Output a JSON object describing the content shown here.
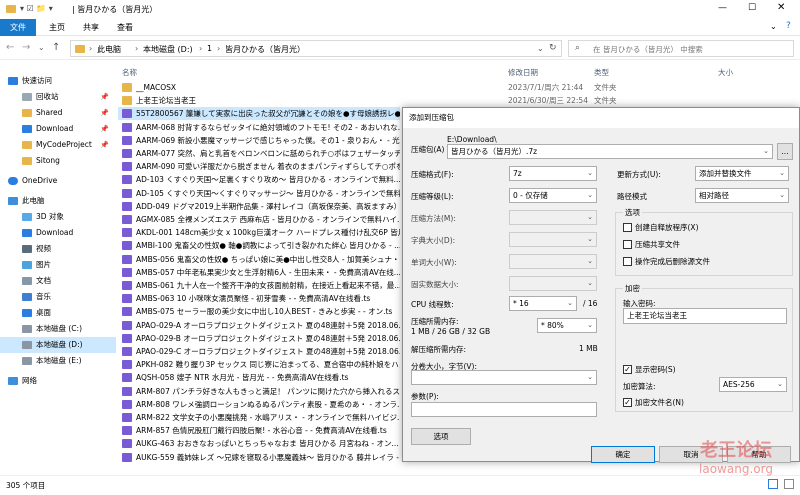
{
  "window": {
    "title": "| 皆月ひかる（皆月光）"
  },
  "ribbon": {
    "tabs": [
      "文件",
      "主页",
      "共享",
      "查看"
    ]
  },
  "address": {
    "path": [
      "此电脑",
      "本地磁盘 (D:)",
      "1",
      "皆月ひかる（皆月光）"
    ],
    "search_placeholder": "在 皆月ひかる（皆月光） 中搜索"
  },
  "sidebar": {
    "items": [
      "快速访问",
      "回收站",
      "Shared",
      "Download",
      "MyCodeProject",
      "Sitong",
      "OneDrive",
      "此电脑",
      "3D 对象",
      "Download",
      "视频",
      "图片",
      "文档",
      "音乐",
      "桌面",
      "本地磁盘 (C:)",
      "本地磁盘 (D:)",
      "本地磁盘 (E:)",
      "网络"
    ]
  },
  "columns": {
    "name": "名称",
    "date": "修改日期",
    "type": "类型",
    "size": "大小"
  },
  "files": [
    {
      "name": "__MACOSX",
      "date": "2023/7/1/周六 21:44",
      "type": "文件夹",
      "kind": "folder"
    },
    {
      "name": "上老王论坛当老王",
      "date": "2021/6/30/周三 22:54",
      "type": "文件夹",
      "kind": "folder"
    },
    {
      "name": "55T2800567 簾嫌して実家に出戻った叔父が冗謙とその娘を●す母娘誘拐レ●...",
      "kind": "video"
    },
    {
      "name": "AARM-068 肘背するならゼッタイに絶対領域のフトモモ! その2 - あおいれな...",
      "kind": "video"
    },
    {
      "name": "AARM-069 新設小悪魔マッサージで感じちゃった僕。その1 - 泉りおん・ - 光...",
      "kind": "video"
    },
    {
      "name": "AARM-077 突然、肩と乳首をベロンベロンに舐められチ○ポはフェザータッチ...",
      "kind": "video"
    },
    {
      "name": "AARM-090 可愛い洋服だから脱ぎません 着衣のままパンティずらしてチ○ポを...",
      "kind": "video"
    },
    {
      "name": "AD-103 くすぐり天国～足裏くすぐり攻め～ 皆月ひかる - オンラインで無料...",
      "kind": "video"
    },
    {
      "name": "AD-105 くすぐり天国～くすぐりマッサージ～ 皆月ひかる - オンラインで無料...",
      "kind": "video"
    },
    {
      "name": "ADD-049 ドグマ2019上半期作品集 - 澤村レイコ（高坂保奈美、高坂ますみ）...",
      "kind": "video"
    },
    {
      "name": "AGMX-085 全裸メンズエステ 西麻布店 - 皆月ひかる - オンラインで無料ハイ...",
      "kind": "video"
    },
    {
      "name": "AKDL-001 148cm美少女 x 100kg巨漢オーク ハードプレス種付け乱交6P 皆月ひ...",
      "kind": "video"
    },
    {
      "name": "AMBI-100 鬼畜父の性奴● 軸●調教によって引き裂かれた絆心 皆月ひかる - ...",
      "kind": "video"
    },
    {
      "name": "AMBS-056 鬼畜父の性奴● ちっぱい娘に美●中出し性交8人 - 加賀美シュナ・...",
      "kind": "video"
    },
    {
      "name": "AMBS-057 中年老私果実少女と生浮射精6人 - 生田未来・ - 免費高清AV在线...",
      "kind": "video"
    },
    {
      "name": "AMBS-061 九十人在一个整齐干净的女孩面前射精，在接近上看起来不错，最...",
      "kind": "video"
    },
    {
      "name": "AMBS-063 10 小咪咪女濡员聚怪 - 初芽雪奏 - - 免費高清AV在线看.ts",
      "kind": "video"
    },
    {
      "name": "AMBS-075 セーラー服の美少女に中出し10人BEST - きみと歩実 - - オン.ts",
      "kind": "video"
    },
    {
      "name": "APAO-029-A オーロラプロジェクトダイジェスト 夏の48連射＋5発 2018.06.ts",
      "kind": "video"
    },
    {
      "name": "APAO-029-B オーロラプロジェクトダイジェスト 夏の48連射＋5発 2018.06.ts",
      "kind": "video"
    },
    {
      "name": "APAO-029-C オーロラプロジェクトダイジェスト 夏の48連射＋5発 2018.06.ts",
      "kind": "video"
    },
    {
      "name": "APKH-082 難り握り3P セックス 同じ寮に泊まってる、夏合宿中の純朴娘をハメ...",
      "kind": "video"
    },
    {
      "name": "AQSH-058 嫂子 NTR 水月光 - 皆月光 - - 免费高清AV在线看.ts",
      "kind": "video"
    },
    {
      "name": "ARM-807 パンチラ好きな人もきっと満足！ パンツに関けた穴から挿入れるスケ...",
      "kind": "video"
    },
    {
      "name": "ARM-808 ワレメ強調ローションぬるぬるパンティ素股 - 夏希のあ・ - オンラ...",
      "kind": "video"
    },
    {
      "name": "ARM-822 文学女子の小悪魔挑発 - 水嶋アリス・ - オンラインで無料ハイビジ...",
      "kind": "video"
    },
    {
      "name": "ARM-857 色情尻股肛门戴行四肢后聚! - 水谷心音 - - 免費高清AV在线看.ts",
      "kind": "video"
    },
    {
      "name": "AUKG-463 おおきなおっぱいとちっちゃなおま 皆月ひかる 月宮ねね - オン...",
      "kind": "video"
    },
    {
      "name": "AUKG-559 義姉妹レズ ～兄嫁を寝取る小悪魔義妹～ 皆月ひかる 藤井レイラ - ...",
      "kind": "video"
    }
  ],
  "status": {
    "count": "305 个项目"
  },
  "dialog": {
    "title": "添加到压缩包",
    "archive_label": "压缩包(A)",
    "archive_dir": "E:\\Download\\",
    "archive_name": "皆月ひかる（皆月光）.7z",
    "browse": "...",
    "format_label": "压缩格式(F):",
    "format_value": "7z",
    "level_label": "压缩等级(L):",
    "level_value": "0 - 仅存储",
    "method_label": "压缩方法(M):",
    "dict_label": "字典大小(D):",
    "word_label": "单词大小(W):",
    "solid_label": "固实数据大小:",
    "cpu_label": "CPU 线程数:",
    "cpu_value": "* 16",
    "cpu_max": "/ 16",
    "mem_label": "压缩所需内存:",
    "mem_detail": "1 MB / 26 GB / 32 GB",
    "mem_value": "* 80%",
    "decomp_label": "解压缩所需内存:",
    "decomp_value": "1 MB",
    "split_label": "分卷大小，字节(V):",
    "params_label": "参数(P):",
    "options_btn": "选项",
    "update_label": "更新方式(U):",
    "update_value": "添加并替换文件",
    "path_label": "路径模式",
    "path_value": "相对路径",
    "options_group": "选项",
    "opt_sfx": "创建自释放程序(X)",
    "opt_shared": "压缩共享文件",
    "opt_delete": "操作完成后删除源文件",
    "encrypt_group": "加密",
    "pwd_label": "输入密码:",
    "pwd_value": "上老王论坛当老王",
    "show_pwd": "显示密码(S)",
    "enc_method_label": "加密算法:",
    "enc_method_value": "AES-256",
    "enc_names": "加密文件名(N)",
    "ok": "确定",
    "cancel": "取消",
    "help": "帮助"
  },
  "watermark": {
    "cn": "老王论坛",
    "en": "laowang.org"
  },
  "colors": {
    "folder": "#e8b54a",
    "video": "#7a5bd6",
    "accent": "#0063b1",
    "highlight": "#cce8ff"
  }
}
